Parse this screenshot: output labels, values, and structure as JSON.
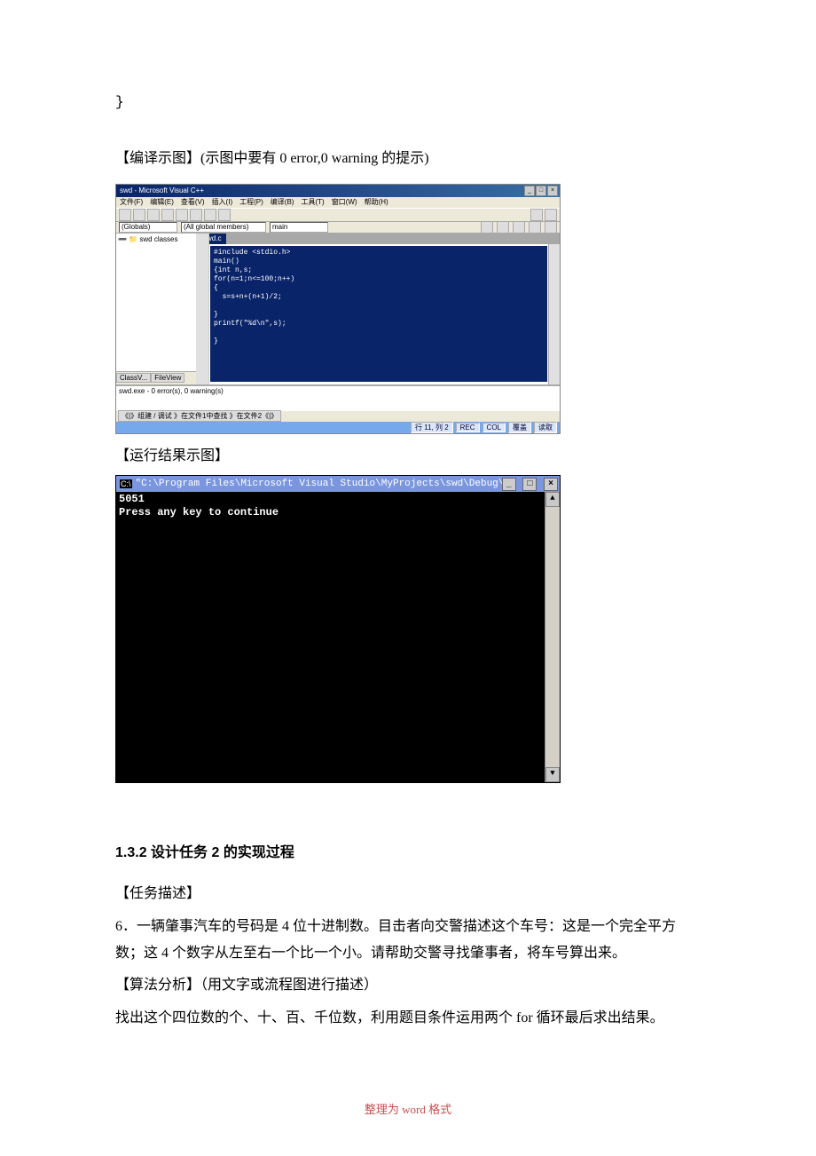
{
  "intro": {
    "closing_brace": "}",
    "compile_caption": "【编译示图】(示图中要有 0 error,0 warning 的提示)"
  },
  "ide": {
    "title": "swd - Microsoft Visual C++",
    "menu": [
      "文件(F)",
      "编辑(E)",
      "查看(V)",
      "插入(I)",
      "工程(P)",
      "编译(B)",
      "工具(T)",
      "窗口(W)",
      "帮助(H)"
    ],
    "globals_drop": "(Globals)",
    "members_drop": "(All global members)",
    "func_drop": "main",
    "sidebar_item": "swd classes",
    "sidebar_tabs": [
      "ClassV...",
      "FileView"
    ],
    "code_tab": "swd.c",
    "code": "#include <stdio.h>\nmain()\n{int n,s;\nfor(n=1;n<=100;n++)\n{\n  s=s+n+(n+1)/2;\n\n}\nprintf(\"%d\\n\",s);\n\n}",
    "output_text": "swd.exe - 0 error(s), 0 warning(s)",
    "output_tabs": "《|》组建 / 调试 》在文件1中查找 》在文件2《|》",
    "status_left": "行 11, 列 2",
    "status_cells": [
      "REC",
      "COL",
      "覆盖",
      "读取"
    ]
  },
  "run_caption": "【运行结果示图】",
  "console": {
    "title": "\"C:\\Program Files\\Microsoft Visual Studio\\MyProjects\\swd\\Debug\\swd.exe\"",
    "line1": "5051",
    "line2": "Press any key to continue"
  },
  "section2": {
    "heading": "1.3.2 设计任务 2 的实现过程",
    "task_label": "【任务描述】",
    "task_body_1": "6．一辆肇事汽车的号码是 4 位十进制数。目击者向交警描述这个车号：这是一个完全平方数；这 4 个数字从左至右一个比一个小。请帮助交警寻找肇事者，将车号算出来。",
    "algo_label": "【算法分析】（用文字或流程图进行描述）",
    "algo_body": "找出这个四位数的个、十、百、千位数，利用题目条件运用两个 for 循环最后求出结果。"
  },
  "footer": "整理为 word 格式"
}
